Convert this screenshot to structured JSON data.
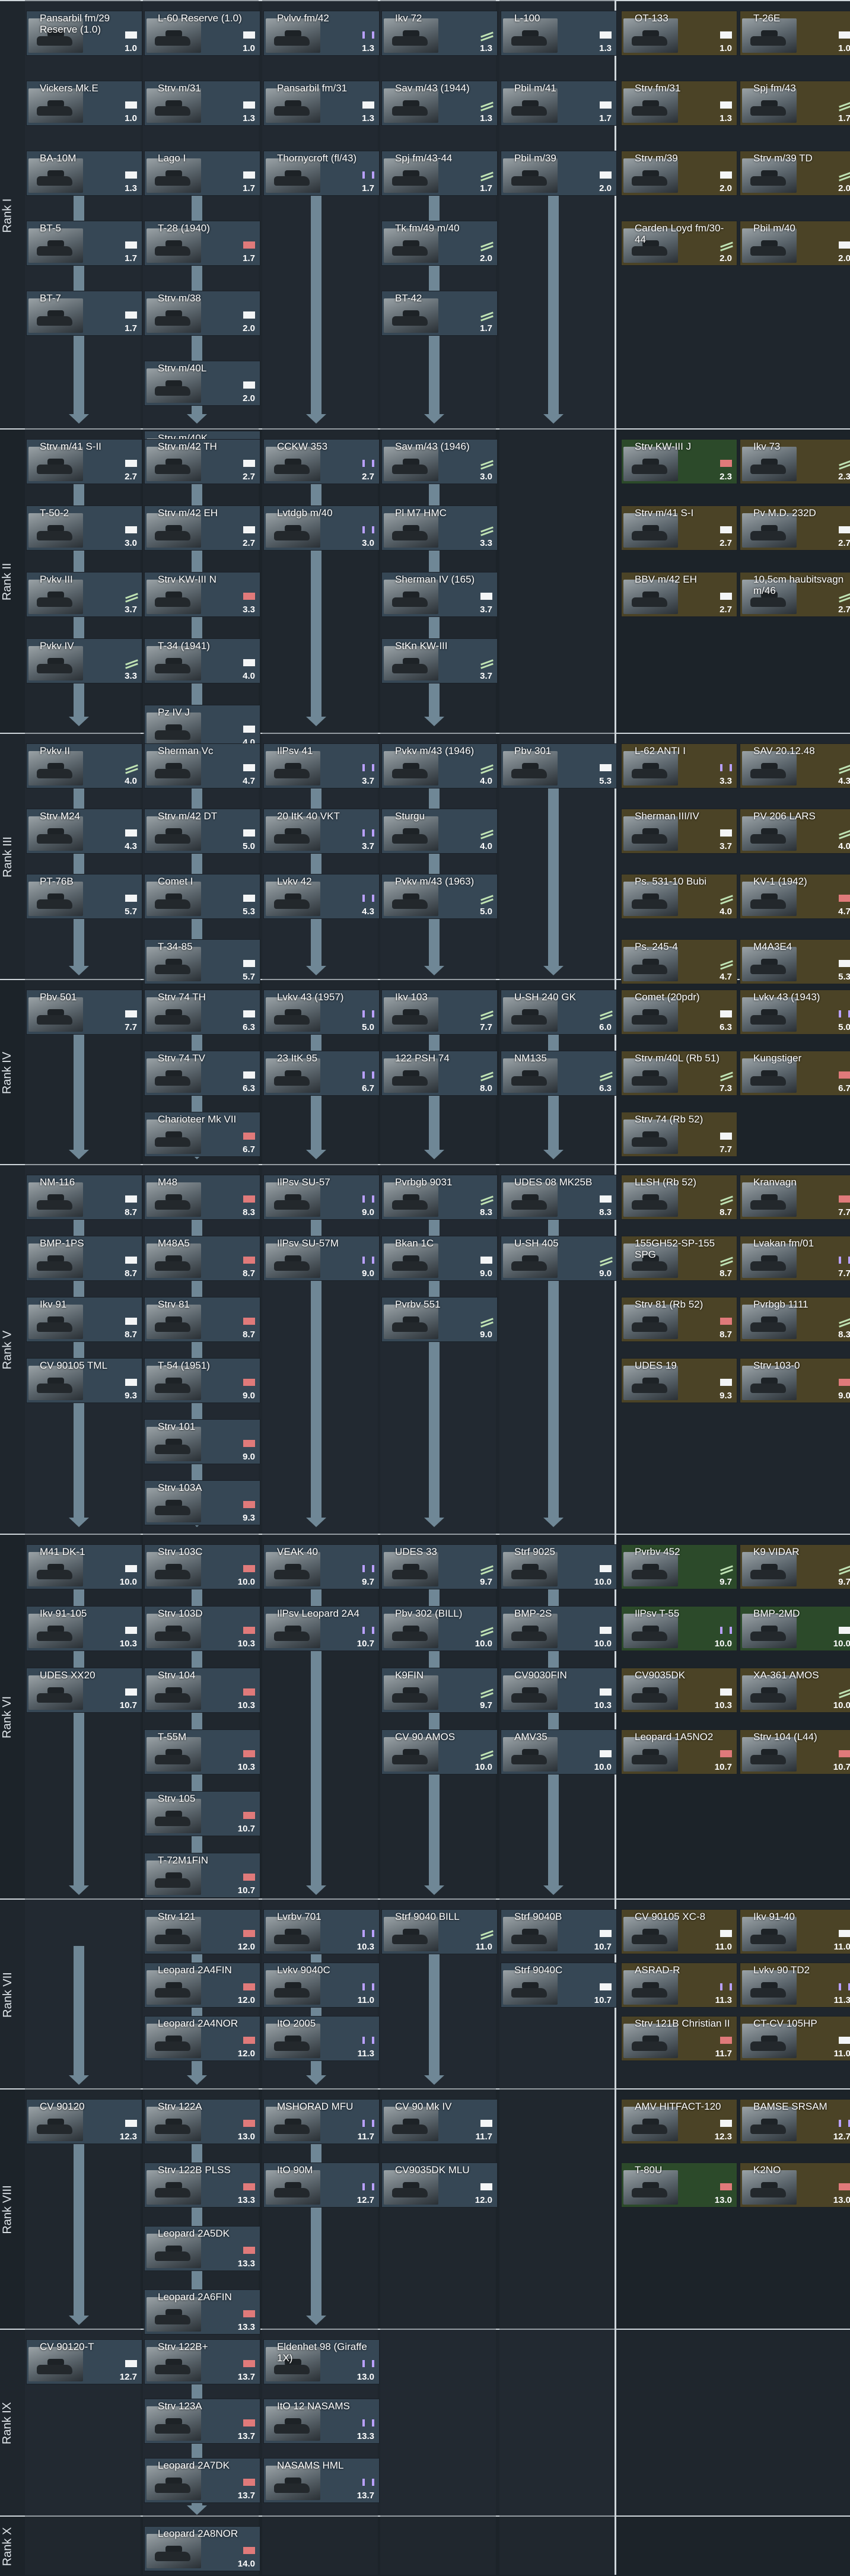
{
  "ranks": [
    "Rank I",
    "Rank II",
    "Rank III",
    "Rank IV",
    "Rank V",
    "Rank VI",
    "Rank VII",
    "Rank VIII",
    "Rank IX",
    "Rank X"
  ],
  "vehicles": [
    {
      "n": "Pansarbil fm/29 Reserve (1.0)",
      "br": "1.0",
      "t": "ground",
      "p": "n"
    },
    {
      "n": "L-60 Reserve (1.0)",
      "br": "1.0",
      "t": "ground",
      "p": "n"
    },
    {
      "n": "Pvlvv fm/42",
      "br": "1.3",
      "t": "spaa",
      "p": "n"
    },
    {
      "n": "Ikv 72",
      "br": "1.3",
      "t": "td",
      "p": "n"
    },
    {
      "n": "L-100",
      "br": "1.3",
      "t": "ground",
      "p": "n"
    },
    {
      "n": "OT-133",
      "br": "1.0",
      "t": "ground",
      "p": "p"
    },
    {
      "n": "T-26E",
      "br": "1.0",
      "t": "ground",
      "p": "p"
    },
    {
      "n": "Vickers Mk.E",
      "br": "1.0",
      "t": "ground",
      "p": "n"
    },
    {
      "n": "Strv m/31",
      "br": "1.3",
      "t": "ground",
      "p": "n"
    },
    {
      "n": "Pansarbil fm/31",
      "br": "1.3",
      "t": "ground",
      "p": "n"
    },
    {
      "n": "Sav m/43 (1944)",
      "br": "1.3",
      "t": "td",
      "p": "n"
    },
    {
      "n": "Pbil m/41",
      "br": "1.7",
      "t": "ground",
      "p": "n"
    },
    {
      "n": "Strv fm/31",
      "br": "1.3",
      "t": "ground",
      "p": "p"
    },
    {
      "n": "Spj fm/43",
      "br": "1.7",
      "t": "td",
      "p": "p"
    },
    {
      "n": "BA-10M",
      "br": "1.3",
      "t": "ground",
      "p": "n"
    },
    {
      "n": "Lago I",
      "br": "1.7",
      "t": "ground",
      "p": "n"
    },
    {
      "n": "Thornycroft (fl/43)",
      "br": "1.7",
      "t": "spaa",
      "p": "n"
    },
    {
      "n": "Spj fm/43-44",
      "br": "1.7",
      "t": "td",
      "p": "n"
    },
    {
      "n": "Pbil m/39",
      "br": "2.0",
      "t": "ground",
      "p": "n"
    },
    {
      "n": "Strv m/39",
      "br": "2.0",
      "t": "ground",
      "p": "p"
    },
    {
      "n": "Strv m/39 TD",
      "br": "2.0",
      "t": "td",
      "p": "p"
    },
    {
      "n": "BT-5",
      "br": "1.7",
      "t": "ground",
      "p": "n"
    },
    {
      "n": "T-28 (1940)",
      "br": "1.7",
      "t": "heavy",
      "p": "n"
    },
    {
      "n": "Tk fm/49 m/40",
      "br": "2.0",
      "t": "td",
      "p": "n"
    },
    {
      "n": "Carden Loyd fm/30-44",
      "br": "2.0",
      "t": "td",
      "p": "p"
    },
    {
      "n": "Pbil m/40",
      "br": "2.0",
      "t": "ground",
      "p": "p"
    },
    {
      "n": "BT-7",
      "br": "1.7",
      "t": "ground",
      "p": "n"
    },
    {
      "n": "Strv m/38",
      "br": "2.0",
      "t": "ground",
      "p": "n"
    },
    {
      "n": "BT-42",
      "br": "1.7",
      "t": "td",
      "p": "n"
    },
    {
      "n": "Strv m/40L",
      "br": "2.0",
      "t": "ground",
      "p": "n"
    },
    {
      "n": "Strv m/40K",
      "br": "2.0",
      "t": "ground",
      "p": "n"
    },
    {
      "n": "Strv m/41 S-II",
      "br": "2.7",
      "t": "ground",
      "p": "n"
    },
    {
      "n": "Strv m/42 TH",
      "br": "2.7",
      "t": "ground",
      "p": "n"
    },
    {
      "n": "CCKW 353",
      "br": "2.7",
      "t": "spaa",
      "p": "n"
    },
    {
      "n": "Sav m/43 (1946)",
      "br": "3.0",
      "t": "td",
      "p": "n"
    },
    {
      "n": "Strv KW-III J",
      "br": "2.3",
      "t": "heavy",
      "p": "s"
    },
    {
      "n": "Ikv 73",
      "br": "2.3",
      "t": "td",
      "p": "p"
    },
    {
      "n": "T-50-2",
      "br": "3.0",
      "t": "ground",
      "p": "n"
    },
    {
      "n": "Strv m/42 EH",
      "br": "2.7",
      "t": "ground",
      "p": "n"
    },
    {
      "n": "Lvtdgb m/40",
      "br": "3.0",
      "t": "spaa",
      "p": "n"
    },
    {
      "n": "Pl M7 HMC",
      "br": "3.3",
      "t": "td",
      "p": "n"
    },
    {
      "n": "Strv m/41 S-I",
      "br": "2.7",
      "t": "ground",
      "p": "p"
    },
    {
      "n": "Pv M.D. 232D",
      "br": "2.7",
      "t": "ground",
      "p": "p"
    },
    {
      "n": "Pvkv III",
      "br": "3.7",
      "t": "td",
      "p": "n"
    },
    {
      "n": "Strv KW-III N",
      "br": "3.3",
      "t": "heavy",
      "p": "n"
    },
    {
      "n": "Sherman IV (165)",
      "br": "3.7",
      "t": "ground",
      "p": "n"
    },
    {
      "n": "BBV m/42 EH",
      "br": "2.7",
      "t": "ground",
      "p": "p"
    },
    {
      "n": "10,5cm haubitsvagn m/46",
      "br": "2.7",
      "t": "td",
      "p": "p"
    },
    {
      "n": "Pvkv IV",
      "br": "3.3",
      "t": "td",
      "p": "n"
    },
    {
      "n": "T-34 (1941)",
      "br": "4.0",
      "t": "ground",
      "p": "n"
    },
    {
      "n": "StKn KW-III",
      "br": "3.7",
      "t": "td",
      "p": "n"
    },
    {
      "n": "Pz IV J",
      "br": "4.0",
      "t": "ground",
      "p": "n"
    },
    {
      "n": "Pvkv II",
      "br": "4.0",
      "t": "td",
      "p": "n"
    },
    {
      "n": "Sherman Vc",
      "br": "4.7",
      "t": "ground",
      "p": "n"
    },
    {
      "n": "IlPsv 41",
      "br": "3.7",
      "t": "spaa",
      "p": "n"
    },
    {
      "n": "Pvkv m/43 (1946)",
      "br": "4.0",
      "t": "td",
      "p": "n"
    },
    {
      "n": "Pbv 301",
      "br": "5.3",
      "t": "ground",
      "p": "n"
    },
    {
      "n": "L-62 ANTI I",
      "br": "3.3",
      "t": "spaa",
      "p": "p"
    },
    {
      "n": "SAV 20.12.48",
      "br": "4.3",
      "t": "td",
      "p": "p"
    },
    {
      "n": "Strv M24",
      "br": "4.3",
      "t": "ground",
      "p": "n"
    },
    {
      "n": "Strv m/42 DT",
      "br": "5.0",
      "t": "ground",
      "p": "n"
    },
    {
      "n": "20 ItK 40 VKT",
      "br": "3.7",
      "t": "spaa",
      "p": "n"
    },
    {
      "n": "Sturgu",
      "br": "4.0",
      "t": "td",
      "p": "n"
    },
    {
      "n": "Sherman III/IV",
      "br": "3.7",
      "t": "ground",
      "p": "p"
    },
    {
      "n": "PV 206 LARS",
      "br": "4.0",
      "t": "td",
      "p": "p"
    },
    {
      "n": "PT-76B",
      "br": "5.7",
      "t": "ground",
      "p": "n"
    },
    {
      "n": "Comet I",
      "br": "5.3",
      "t": "ground",
      "p": "n"
    },
    {
      "n": "Lvkv 42",
      "br": "4.3",
      "t": "spaa",
      "p": "n"
    },
    {
      "n": "Pvkv m/43 (1963)",
      "br": "5.0",
      "t": "td",
      "p": "n"
    },
    {
      "n": "Ps. 531-10 Bubi",
      "br": "4.0",
      "t": "td",
      "p": "p"
    },
    {
      "n": "KV-1 (1942)",
      "br": "4.7",
      "t": "heavy",
      "p": "p"
    },
    {
      "n": "T-34-85",
      "br": "5.7",
      "t": "ground",
      "p": "n"
    },
    {
      "n": "Ps. 245-4",
      "br": "4.7",
      "t": "td",
      "p": "p"
    },
    {
      "n": "M4A3E4",
      "br": "5.3",
      "t": "ground",
      "p": "p"
    },
    {
      "n": "Pbv 501",
      "br": "7.7",
      "t": "ground",
      "p": "n"
    },
    {
      "n": "Strv 74 TH",
      "br": "6.3",
      "t": "ground",
      "p": "n"
    },
    {
      "n": "Lvkv 43 (1957)",
      "br": "5.0",
      "t": "spaa",
      "p": "n"
    },
    {
      "n": "Ikv 103",
      "br": "7.7",
      "t": "td",
      "p": "n"
    },
    {
      "n": "U-SH 240 GK",
      "br": "6.0",
      "t": "td",
      "p": "n"
    },
    {
      "n": "Comet (20pdr)",
      "br": "6.3",
      "t": "ground",
      "p": "p"
    },
    {
      "n": "Lvkv 43 (1943)",
      "br": "5.0",
      "t": "spaa",
      "p": "p"
    },
    {
      "n": "Strv 74 TV",
      "br": "6.3",
      "t": "ground",
      "p": "n"
    },
    {
      "n": "23 ItK 95",
      "br": "6.7",
      "t": "spaa",
      "p": "n"
    },
    {
      "n": "122 PSH 74",
      "br": "8.0",
      "t": "td",
      "p": "n"
    },
    {
      "n": "NM135",
      "br": "6.3",
      "t": "td",
      "p": "n"
    },
    {
      "n": "Strv m/40L (Rb 51)",
      "br": "7.3",
      "t": "td",
      "p": "p"
    },
    {
      "n": "Kungstiger",
      "br": "6.7",
      "t": "heavy",
      "p": "p"
    },
    {
      "n": "Charioteer Mk VII",
      "br": "6.7",
      "t": "heavy",
      "p": "n"
    },
    {
      "n": "Strv 74 (Rb 52)",
      "br": "7.7",
      "t": "ground",
      "p": "p"
    },
    {
      "n": "NM-116",
      "br": "8.7",
      "t": "ground",
      "p": "n"
    },
    {
      "n": "M48",
      "br": "8.3",
      "t": "heavy",
      "p": "n"
    },
    {
      "n": "IlPsv SU-57",
      "br": "9.0",
      "t": "spaa",
      "p": "n"
    },
    {
      "n": "Pvrbgb 9031",
      "br": "8.3",
      "t": "td",
      "p": "n"
    },
    {
      "n": "UDES 08 MK25B",
      "br": "8.3",
      "t": "ground",
      "p": "n"
    },
    {
      "n": "LLSH (Rb 52)",
      "br": "8.7",
      "t": "td",
      "p": "p"
    },
    {
      "n": "Kranvagn",
      "br": "7.7",
      "t": "heavy",
      "p": "p"
    },
    {
      "n": "BMP-1PS",
      "br": "8.7",
      "t": "ground",
      "p": "n"
    },
    {
      "n": "M48A5",
      "br": "8.7",
      "t": "heavy",
      "p": "n"
    },
    {
      "n": "IlPsv SU-57M",
      "br": "9.0",
      "t": "spaa",
      "p": "n"
    },
    {
      "n": "Bkan 1C",
      "br": "9.0",
      "t": "ground",
      "p": "n"
    },
    {
      "n": "U-SH 405",
      "br": "9.0",
      "t": "td",
      "p": "n"
    },
    {
      "n": "155GH52-SP-155 SPG",
      "br": "8.7",
      "t": "td",
      "p": "p"
    },
    {
      "n": "Lvakan fm/01",
      "br": "7.7",
      "t": "spaa",
      "p": "p"
    },
    {
      "n": "Ikv 91",
      "br": "8.7",
      "t": "ground",
      "p": "n"
    },
    {
      "n": "Strv 81",
      "br": "8.7",
      "t": "heavy",
      "p": "n"
    },
    {
      "n": "Pvrbv 551",
      "br": "9.0",
      "t": "td",
      "p": "n"
    },
    {
      "n": "Strv 81 (Rb 52)",
      "br": "8.7",
      "t": "heavy",
      "p": "p"
    },
    {
      "n": "Pvrbgb 1111",
      "br": "8.3",
      "t": "td",
      "p": "p"
    },
    {
      "n": "CV 90105 TML",
      "br": "9.3",
      "t": "ground",
      "p": "n"
    },
    {
      "n": "T-54 (1951)",
      "br": "9.0",
      "t": "heavy",
      "p": "n"
    },
    {
      "n": "UDES 19",
      "br": "9.3",
      "t": "ground",
      "p": "p"
    },
    {
      "n": "Strv 103-0",
      "br": "9.0",
      "t": "heavy",
      "p": "p"
    },
    {
      "n": "Strv 101",
      "br": "9.0",
      "t": "heavy",
      "p": "n"
    },
    {
      "n": "Strv 103A",
      "br": "9.3",
      "t": "heavy",
      "p": "n"
    },
    {
      "n": "M41 DK-1",
      "br": "10.0",
      "t": "ground",
      "p": "n"
    },
    {
      "n": "Strv 103C",
      "br": "10.0",
      "t": "heavy",
      "p": "n"
    },
    {
      "n": "VEAK 40",
      "br": "9.7",
      "t": "spaa",
      "p": "n"
    },
    {
      "n": "UDES 33",
      "br": "9.7",
      "t": "td",
      "p": "n"
    },
    {
      "n": "Strf 9025",
      "br": "10.0",
      "t": "ground",
      "p": "n"
    },
    {
      "n": "Pvrbv 452",
      "br": "9.7",
      "t": "td",
      "p": "s"
    },
    {
      "n": "K9 VIDAR",
      "br": "9.7",
      "t": "td",
      "p": "p"
    },
    {
      "n": "Ikv 91-105",
      "br": "10.3",
      "t": "ground",
      "p": "n"
    },
    {
      "n": "Strv 103D",
      "br": "10.3",
      "t": "heavy",
      "p": "n"
    },
    {
      "n": "IlPsv Leopard 2A4",
      "br": "10.7",
      "t": "spaa",
      "p": "n"
    },
    {
      "n": "Pbv 302 (BILL)",
      "br": "10.0",
      "t": "td",
      "p": "n"
    },
    {
      "n": "BMP-2S",
      "br": "10.0",
      "t": "ground",
      "p": "n"
    },
    {
      "n": "IlPsv T-55",
      "br": "10.0",
      "t": "spaa",
      "p": "s"
    },
    {
      "n": "BMP-2MD",
      "br": "10.0",
      "t": "ground",
      "p": "s"
    },
    {
      "n": "UDES XX20",
      "br": "10.7",
      "t": "ground",
      "p": "n"
    },
    {
      "n": "Strv 104",
      "br": "10.3",
      "t": "heavy",
      "p": "n"
    },
    {
      "n": "K9FIN",
      "br": "9.7",
      "t": "td",
      "p": "n"
    },
    {
      "n": "CV9030FIN",
      "br": "10.3",
      "t": "ground",
      "p": "n"
    },
    {
      "n": "CV9035DK",
      "br": "10.3",
      "t": "ground",
      "p": "p"
    },
    {
      "n": "XA-361 AMOS",
      "br": "10.0",
      "t": "td",
      "p": "p"
    },
    {
      "n": "T-55M",
      "br": "10.3",
      "t": "heavy",
      "p": "n"
    },
    {
      "n": "CV 90 AMOS",
      "br": "10.0",
      "t": "td",
      "p": "n"
    },
    {
      "n": "AMV35",
      "br": "10.0",
      "t": "ground",
      "p": "n"
    },
    {
      "n": "Leopard 1A5NO2",
      "br": "10.7",
      "t": "heavy",
      "p": "p"
    },
    {
      "n": "Strv 104 (L44)",
      "br": "10.7",
      "t": "heavy",
      "p": "p"
    },
    {
      "n": "Strv 105",
      "br": "10.7",
      "t": "heavy",
      "p": "n"
    },
    {
      "n": "T-72M1FIN",
      "br": "10.7",
      "t": "heavy",
      "p": "n"
    },
    {
      "n": "Strv 121",
      "br": "12.0",
      "t": "heavy",
      "p": "n"
    },
    {
      "n": "Lvrbv 701",
      "br": "10.3",
      "t": "spaa",
      "p": "n"
    },
    {
      "n": "Strf 9040 BILL",
      "br": "11.0",
      "t": "td",
      "p": "n"
    },
    {
      "n": "Strf 9040B",
      "br": "10.7",
      "t": "ground",
      "p": "n"
    },
    {
      "n": "CV 90105 XC-8",
      "br": "11.0",
      "t": "ground",
      "p": "p"
    },
    {
      "n": "Ikv 91-40",
      "br": "11.0",
      "t": "ground",
      "p": "p"
    },
    {
      "n": "Leopard 2A4FIN",
      "br": "12.0",
      "t": "heavy",
      "p": "n"
    },
    {
      "n": "Lvkv 9040C",
      "br": "11.0",
      "t": "spaa",
      "p": "n"
    },
    {
      "n": "Strf 9040C",
      "br": "10.7",
      "t": "ground",
      "p": "n"
    },
    {
      "n": "ASRAD-R",
      "br": "11.3",
      "t": "spaa",
      "p": "p"
    },
    {
      "n": "Lvkv 90 TD2",
      "br": "11.3",
      "t": "spaa",
      "p": "p"
    },
    {
      "n": "Leopard 2A4NOR",
      "br": "12.0",
      "t": "heavy",
      "p": "n"
    },
    {
      "n": "ItO 2005",
      "br": "11.3",
      "t": "spaa",
      "p": "n"
    },
    {
      "n": "Strv 121B Christian II",
      "br": "11.7",
      "t": "heavy",
      "p": "p"
    },
    {
      "n": "CT-CV 105HP",
      "br": "11.0",
      "t": "ground",
      "p": "p"
    },
    {
      "n": "CV 90120",
      "br": "12.3",
      "t": "ground",
      "p": "n"
    },
    {
      "n": "Strv 122A",
      "br": "13.0",
      "t": "heavy",
      "p": "n"
    },
    {
      "n": "MSHORAD MFU",
      "br": "11.7",
      "t": "spaa",
      "p": "n"
    },
    {
      "n": "CV 90 Mk IV",
      "br": "11.7",
      "t": "ground",
      "p": "n"
    },
    {
      "n": "AMV HITFACT-120",
      "br": "12.3",
      "t": "ground",
      "p": "p"
    },
    {
      "n": "BAMSE SRSAM",
      "br": "12.7",
      "t": "spaa",
      "p": "p"
    },
    {
      "n": "Strv 122B PLSS",
      "br": "13.3",
      "t": "heavy",
      "p": "n"
    },
    {
      "n": "ItO 90M",
      "br": "12.7",
      "t": "spaa",
      "p": "n"
    },
    {
      "n": "CV9035DK MLU",
      "br": "12.0",
      "t": "ground",
      "p": "n"
    },
    {
      "n": "T-80U",
      "br": "13.0",
      "t": "heavy",
      "p": "s"
    },
    {
      "n": "K2NO",
      "br": "13.0",
      "t": "heavy",
      "p": "p"
    },
    {
      "n": "Leopard 2A5DK",
      "br": "13.3",
      "t": "heavy",
      "p": "n"
    },
    {
      "n": "Leopard 2A6FIN",
      "br": "13.3",
      "t": "heavy",
      "p": "n"
    },
    {
      "n": "CV 90120-T",
      "br": "12.7",
      "t": "ground",
      "p": "n"
    },
    {
      "n": "Strv 122B+",
      "br": "13.7",
      "t": "heavy",
      "p": "n"
    },
    {
      "n": "Eldenhet 98 (Giraffe 1X)",
      "br": "13.0",
      "t": "spaa",
      "p": "n"
    },
    {
      "n": "Strv 123A",
      "br": "13.7",
      "t": "heavy",
      "p": "n"
    },
    {
      "n": "ItO 12 NASAMS",
      "br": "13.3",
      "t": "spaa",
      "p": "n"
    },
    {
      "n": "Leopard 2A7DK",
      "br": "13.7",
      "t": "heavy",
      "p": "n"
    },
    {
      "n": "NASAMS HML",
      "br": "13.7",
      "t": "spaa",
      "p": "n"
    },
    {
      "n": "Leopard 2A8NOR",
      "br": "14.0",
      "t": "heavy",
      "p": "n"
    }
  ]
}
